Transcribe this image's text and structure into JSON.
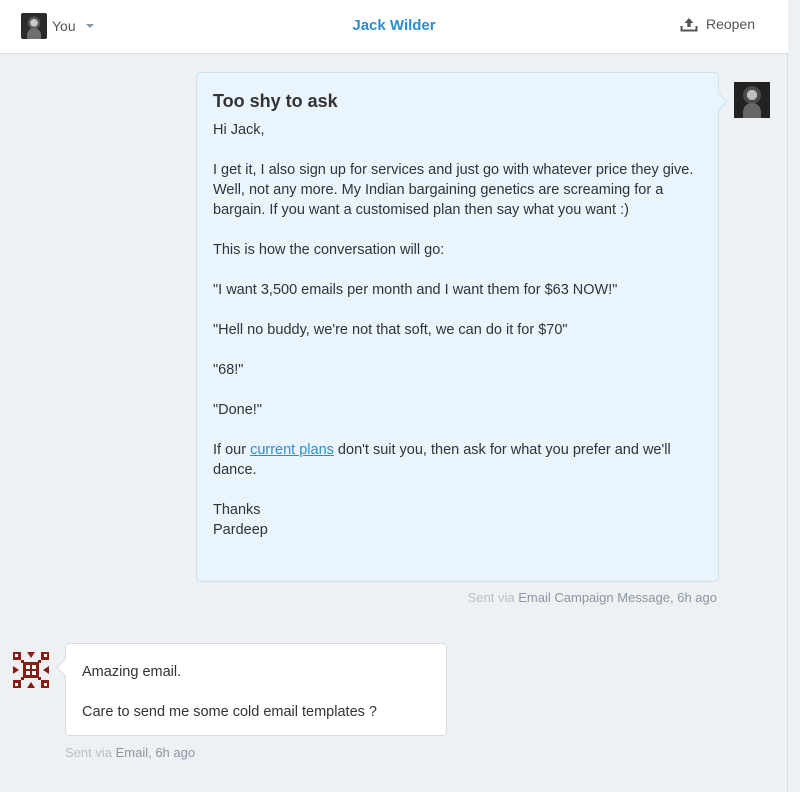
{
  "header": {
    "assignee_label": "You",
    "title": "Jack Wilder",
    "reopen_label": "Reopen"
  },
  "outgoing_message": {
    "subject": "Too shy to ask",
    "greeting": "Hi Jack,",
    "paragraph_1": "I get it, I also sign up for services and just go with whatever price they give. Well, not any more. My Indian bargaining genetics are screaming for a bargain. If you want a customised plan then say what you want :)",
    "paragraph_2": "This is how the conversation will go:",
    "quote_1": "\"I want 3,500 emails per month and I want them for $63 NOW!\"",
    "quote_2": "\"Hell no buddy, we're not that soft, we can do it for $70\"",
    "quote_3": "\"68!\"",
    "quote_4": "\"Done!\"",
    "plans_prefix": "If our ",
    "plans_link": "current plans",
    "plans_suffix": " don't suit you, then ask for what you prefer and we'll dance.",
    "signoff_1": "Thanks",
    "signoff_2": "Pardeep",
    "meta_prefix": "Sent via ",
    "meta_detail": "Email Campaign Message, 6h ago"
  },
  "incoming_message": {
    "line_1": "Amazing email.",
    "line_2": "Care to send me some cold email templates ?",
    "meta_prefix": "Sent via ",
    "meta_detail": "Email, 6h ago"
  },
  "colors": {
    "accent": "#2a8ecf",
    "outgoing_bubble": "#e9f4fd",
    "background": "#eef1f4",
    "identicon": "#8b1c12"
  },
  "icons": {
    "assignee_avatar": "user-photo",
    "dropdown": "caret-down-icon",
    "reopen": "reopen-upload-icon",
    "user_avatar": "identicon"
  }
}
